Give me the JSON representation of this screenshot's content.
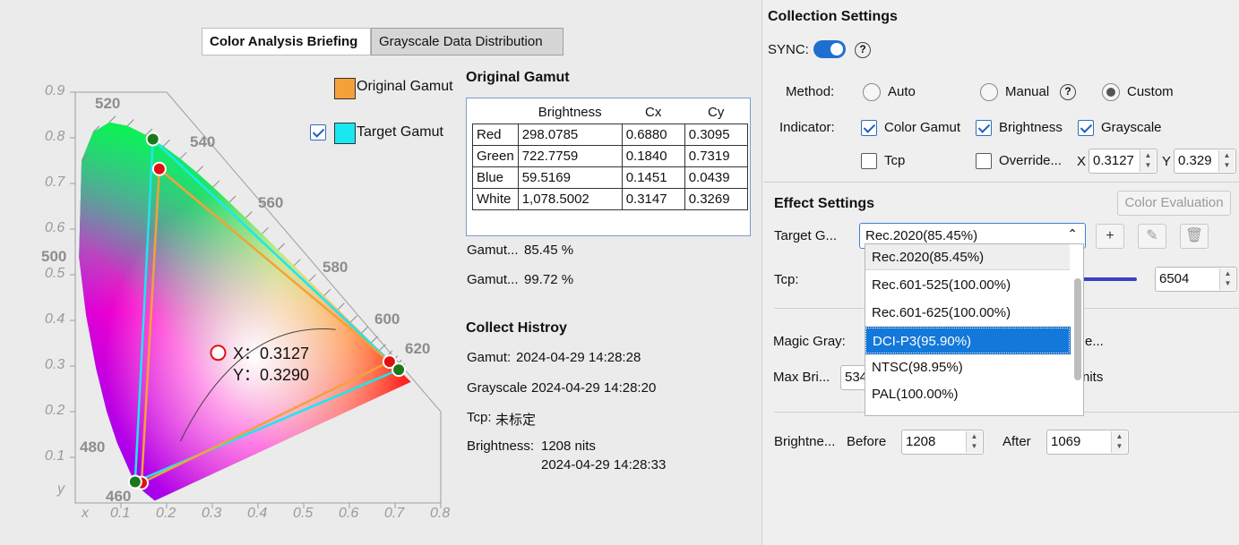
{
  "tabs": [
    {
      "label": "Color Analysis Briefing",
      "active": true
    },
    {
      "label": "Grayscale Data Distribution",
      "active": false
    }
  ],
  "legend": {
    "original": {
      "label": "Original Gamut",
      "color": "#f4a13a"
    },
    "target": {
      "label": "Target Gamut",
      "color": "#19e8f0",
      "checked": true
    }
  },
  "cie_chart": {
    "y_ticks": [
      "0.9",
      "0.8",
      "0.7",
      "0.6",
      "0.5",
      "0.4",
      "0.3",
      "0.2",
      "0.1"
    ],
    "y_axis_label": "y",
    "x_ticks": [
      "0.1",
      "0.2",
      "0.3",
      "0.4",
      "0.5",
      "0.6",
      "0.7",
      "0.8"
    ],
    "x_axis_label": "x",
    "wavelengths": [
      "520",
      "540",
      "560",
      "580",
      "600",
      "620",
      "500",
      "480",
      "460"
    ],
    "whitepoint_x_label": "X：0.3127",
    "whitepoint_y_label": "Y：0.3290",
    "original_gamut": {
      "red": [
        0.688,
        0.3095
      ],
      "green": [
        0.184,
        0.7319
      ],
      "blue": [
        0.1451,
        0.0439
      ]
    },
    "target_gamut": {
      "red": [
        0.708,
        0.292
      ],
      "green": [
        0.17,
        0.797
      ],
      "blue": [
        0.131,
        0.046
      ]
    },
    "white_point": [
      0.3127,
      0.329
    ]
  },
  "original_gamut": {
    "title": "Original Gamut",
    "headers": [
      "",
      "Brightness",
      "Cx",
      "Cy"
    ],
    "rows": [
      [
        "Red",
        "298.0785",
        "0.6880",
        "0.3095"
      ],
      [
        "Green",
        "722.7759",
        "0.1840",
        "0.7319"
      ],
      [
        "Blue",
        "59.5169",
        "0.1451",
        "0.0439"
      ],
      [
        "White",
        "1,078.5002",
        "0.3147",
        "0.3269"
      ]
    ],
    "stat1_label": "Gamut...",
    "stat1_value": "85.45 %",
    "stat2_label": "Gamut...",
    "stat2_value": "99.72 %"
  },
  "history": {
    "title": "Collect Histroy",
    "gamut_label": "Gamut:",
    "gamut_value": "2024-04-29 14:28:28",
    "grayscale_label": "Grayscale",
    "grayscale_value": "2024-04-29 14:28:20",
    "tcp_label": "Tcp:",
    "tcp_value": "未标定",
    "brightness_label": "Brightness:",
    "brightness_value": "1208 nits",
    "brightness_time": "2024-04-29 14:28:33"
  },
  "collection": {
    "title": "Collection Settings",
    "sync_label": "SYNC:",
    "sync_on": true,
    "method_label": "Method:",
    "methods": [
      {
        "label": "Auto",
        "checked": false
      },
      {
        "label": "Manual",
        "checked": false
      },
      {
        "label": "Custom",
        "checked": true
      }
    ],
    "indicator_label": "Indicator:",
    "indicators": [
      {
        "label": "Color Gamut",
        "checked": true
      },
      {
        "label": "Brightness",
        "checked": true
      },
      {
        "label": "Grayscale",
        "checked": true
      },
      {
        "label": "Tcp",
        "checked": false
      },
      {
        "label": "Override...",
        "checked": false
      }
    ],
    "x_label": "X",
    "x_value": "0.3127",
    "y_label": "Y",
    "y_value": "0.329"
  },
  "effect": {
    "title": "Effect Settings",
    "color_eval_label": "Color Evaluation",
    "target_label": "Target G...",
    "target_value": "Rec.2020(85.45%)",
    "tcp_label": "Tcp:",
    "tcp_value": "6504",
    "magic_label": "Magic Gray:",
    "magic_tail": "e...",
    "maxbri_label": "Max Bri...",
    "maxbri_value": "534",
    "maxbri_unit": "nits",
    "brightness_label": "Brightne...",
    "before_label": "Before",
    "before_value": "1208",
    "after_label": "After",
    "after_value": "1069"
  },
  "dropdown": {
    "items": [
      "Rec.2020(85.45%)",
      "Rec.601-525(100.00%)",
      "Rec.601-625(100.00%)",
      "DCI-P3(95.90%)",
      "NTSC(98.95%)",
      "PAL(100.00%)"
    ],
    "selected_index": 3
  },
  "colors": {
    "accent": "#1378d9",
    "toggle": "#1f6fd1",
    "slider": "#3b3fc9"
  }
}
